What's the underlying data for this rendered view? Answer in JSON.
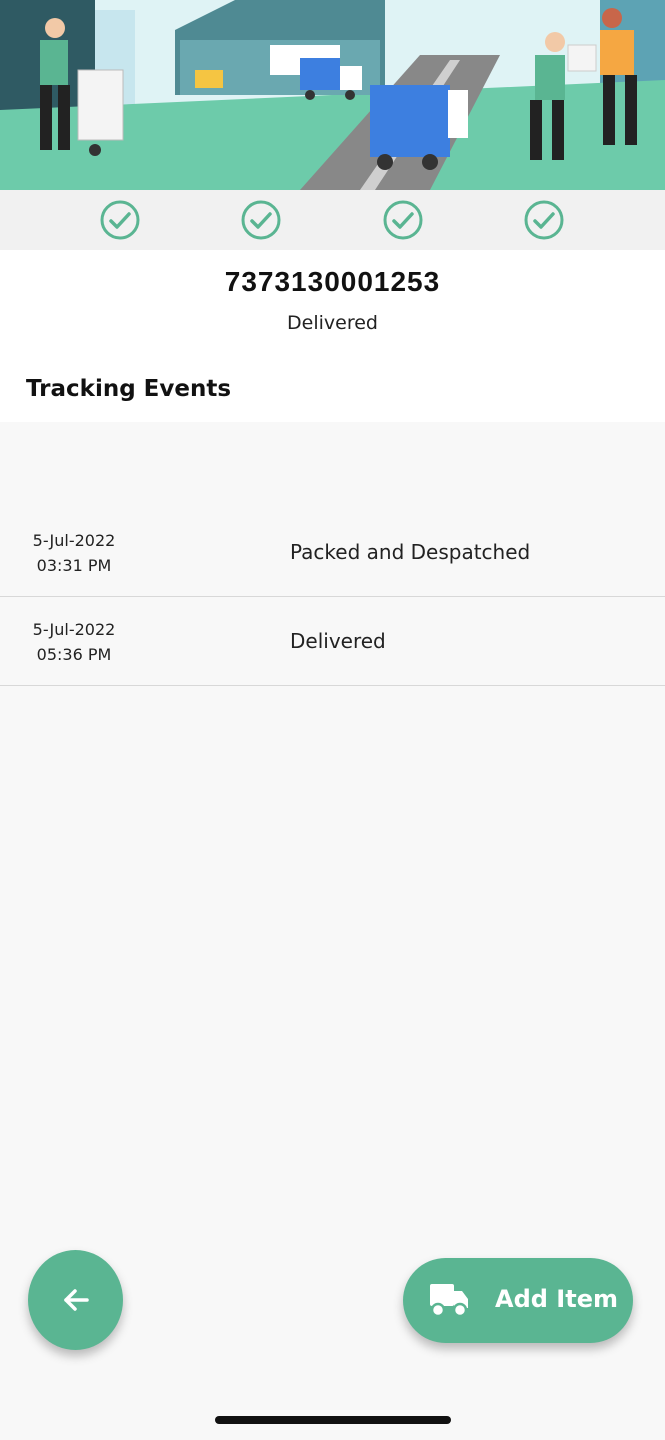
{
  "colors": {
    "accent": "#5ab592",
    "hero_ground": "#6dcbaa",
    "step_check": "#5ab592",
    "truck_blue": "#3d7fe0"
  },
  "progress_steps": [
    {
      "icon": "check-circle-icon",
      "completed": true
    },
    {
      "icon": "check-circle-icon",
      "completed": true
    },
    {
      "icon": "check-circle-icon",
      "completed": true
    },
    {
      "icon": "check-circle-icon",
      "completed": true
    }
  ],
  "shipment": {
    "tracking_number": "7373130001253",
    "status": "Delivered"
  },
  "tracking": {
    "title": "Tracking Events",
    "events": [
      {
        "date": "5-Jul-2022",
        "time": "03:31 PM",
        "description": "Packed and Despatched"
      },
      {
        "date": "5-Jul-2022",
        "time": "05:36 PM",
        "description": "Delivered"
      }
    ]
  },
  "actions": {
    "back_icon": "arrow-left-icon",
    "add_item_label": "Add Item",
    "add_item_icon": "truck-icon"
  }
}
